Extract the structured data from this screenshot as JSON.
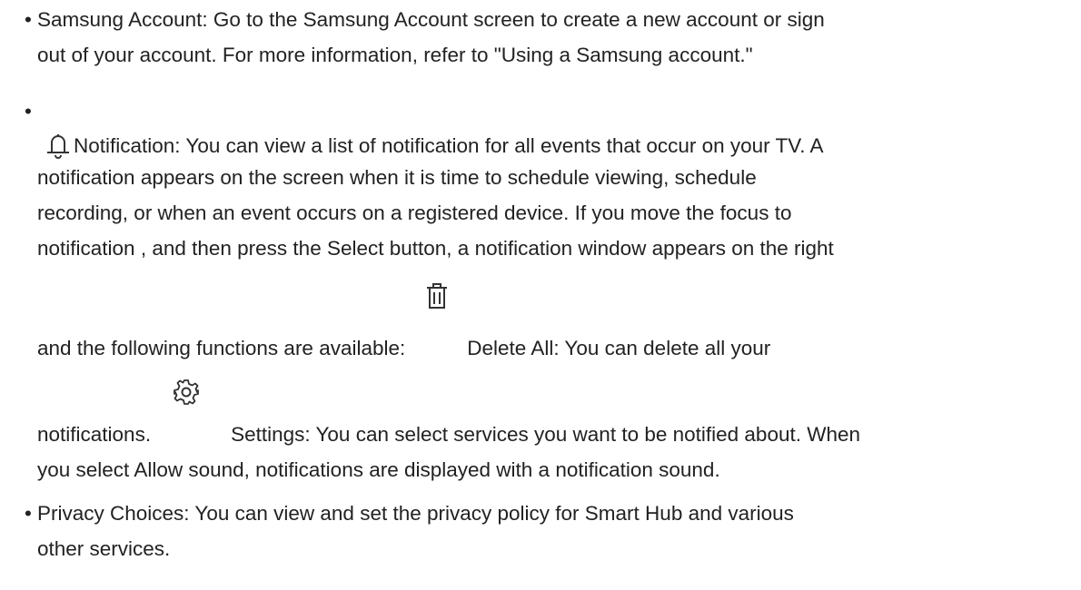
{
  "items": [
    {
      "bullet": "•",
      "lines": [
        "Samsung Account: Go to the Samsung Account screen to create a new account or sign",
        "out of your account. For more information, refer to \"Using a Samsung account.\""
      ]
    },
    {
      "bullet": "•",
      "icon": "bell-icon",
      "lines": [
        "Notification: You can view a list of notification for all events that occur on your TV. A",
        "notification appears on the screen when it is time to schedule viewing, schedule",
        "recording, or when an event occurs on a registered device. If you move the focus to",
        "notification , and then press the Select button, a notification window appears on the right"
      ],
      "delete_intro": "and the following functions are available:",
      "delete_icon": "trash-icon",
      "delete_text": "Delete All: You can delete all your",
      "settings_intro": "notifications.",
      "settings_icon": "gear-icon",
      "settings_text": "Settings: You can select services you want to be notified about. When",
      "last_line": "you select Allow sound, notifications are displayed with a notification sound."
    },
    {
      "bullet": "•",
      "lines": [
        "Privacy Choices: You can view and set the privacy policy for Smart Hub and various",
        "other services."
      ]
    }
  ]
}
